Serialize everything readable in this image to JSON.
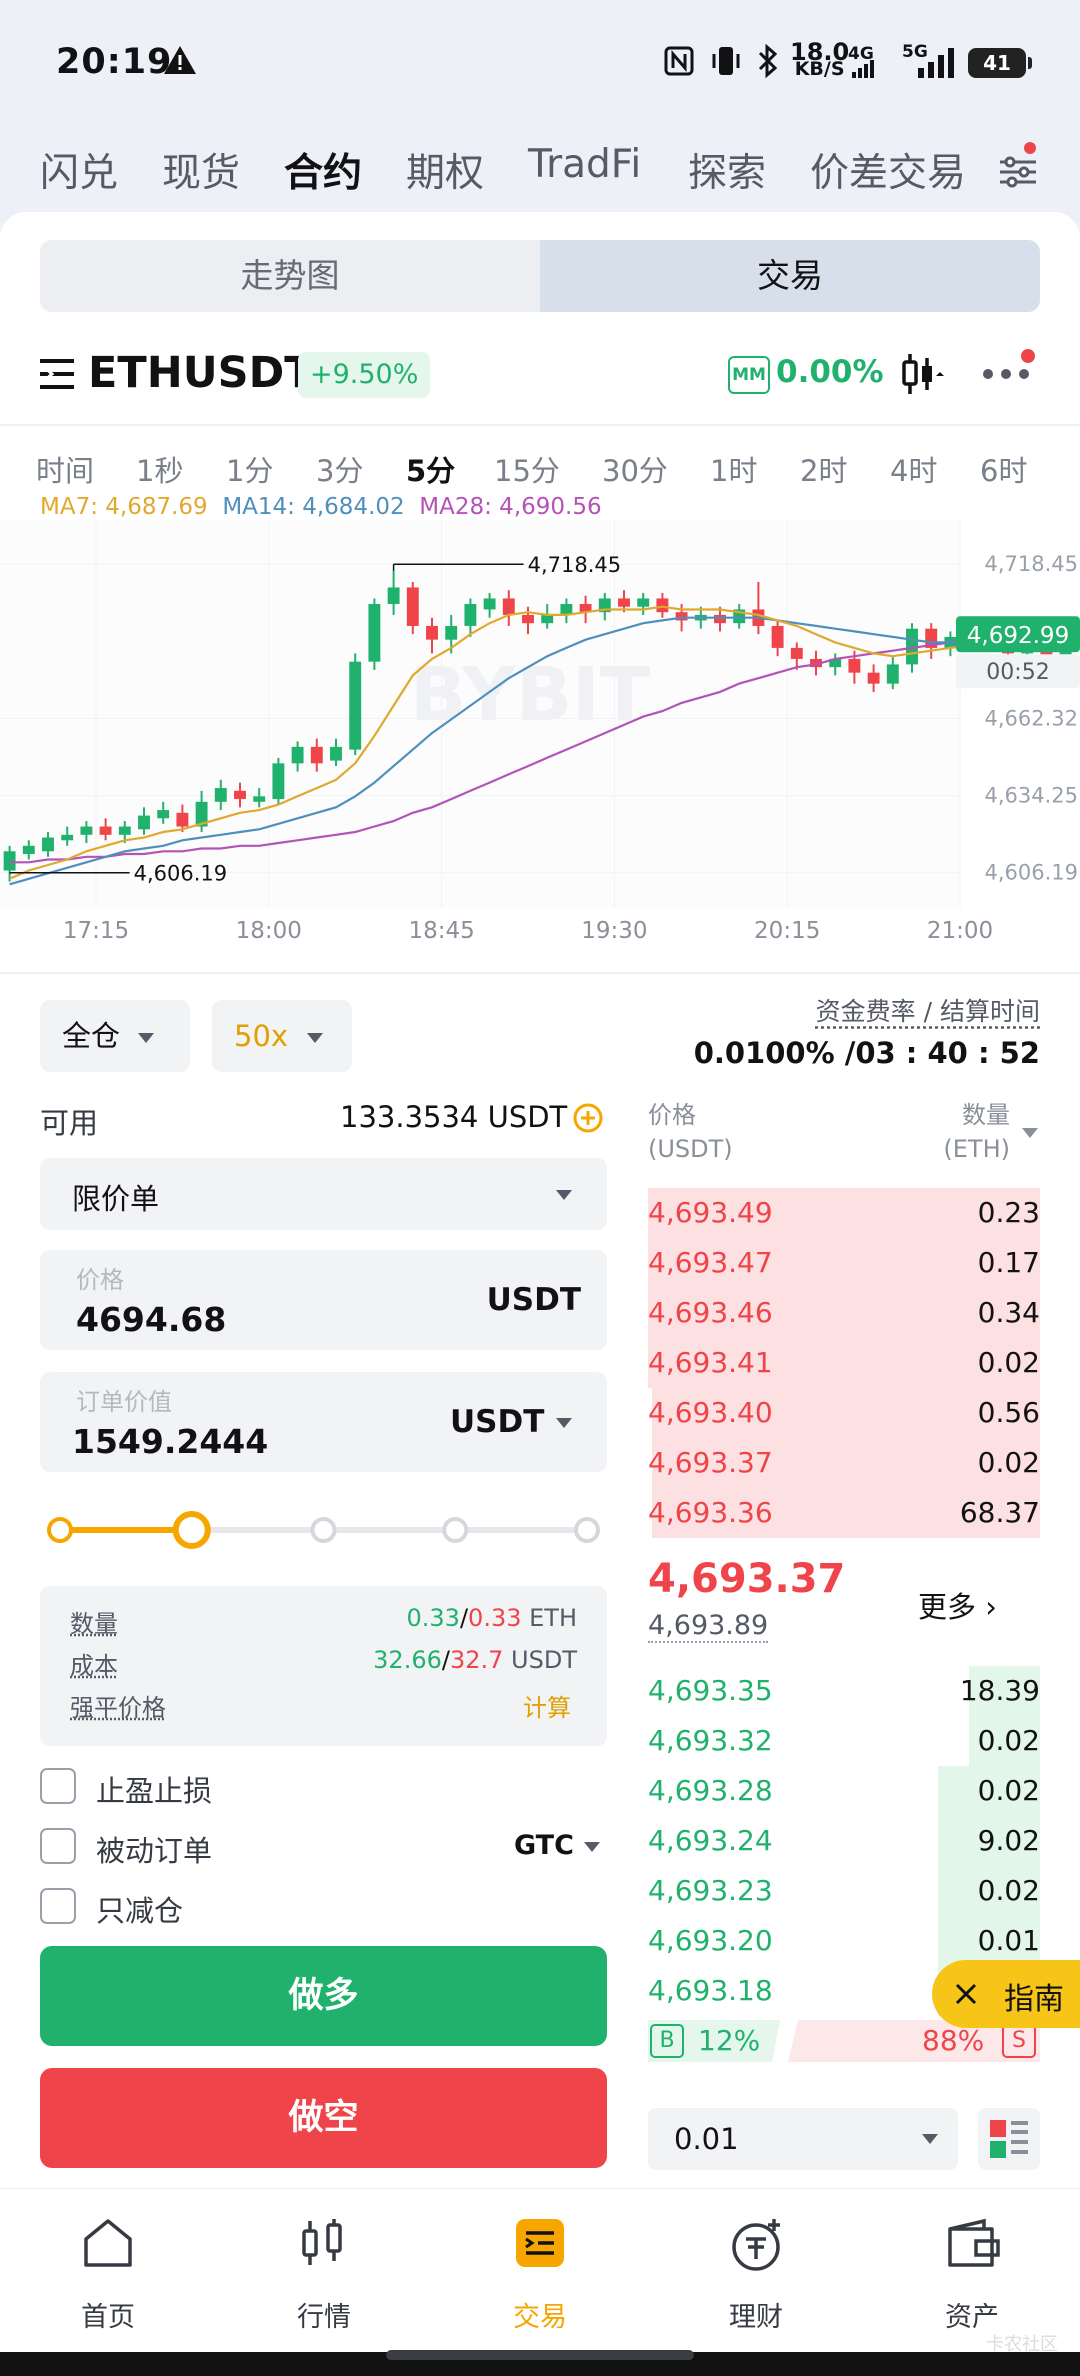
{
  "status_bar": {
    "time": "20:19",
    "net_speed": "18.0",
    "net_unit": "KB/S",
    "signal_4g": "4G",
    "signal_5g": "5G",
    "battery": "41"
  },
  "top_nav": {
    "items": [
      "闪兑",
      "现货",
      "合约",
      "期权",
      "TradFi",
      "探索",
      "价差交易"
    ],
    "active": "合约"
  },
  "view_tabs": {
    "chart": "走势图",
    "trade": "交易"
  },
  "instrument": {
    "symbol": "ETHUSDT",
    "change": "+9.50%",
    "mm_badge": "MM",
    "mm_value": "0.00%"
  },
  "timeframes": [
    "时间",
    "1秒",
    "1分",
    "3分",
    "5分",
    "15分",
    "30分",
    "1时",
    "2时",
    "4时",
    "6时"
  ],
  "active_timeframe": "5分",
  "ma": {
    "ma7": "MA7: 4,687.69",
    "ma14": "MA14: 4,684.02",
    "ma28": "MA28: 4,690.56"
  },
  "chart_data": {
    "type": "candlestick",
    "watermark": "BYBIT",
    "y_ticks": [
      "4,718.45",
      "4,662.32",
      "4,634.25",
      "4,606.19"
    ],
    "x_ticks": [
      "17:15",
      "18:00",
      "18:45",
      "19:30",
      "20:15",
      "21:00"
    ],
    "high_marker": "4,718.45",
    "low_marker": "4,606.19",
    "last_price": "4,692.99",
    "countdown": "00:52",
    "ylim": [
      4597,
      4728
    ],
    "x_range": [
      "16:50",
      "21:00"
    ],
    "interval_minutes": 5,
    "candles": [
      [
        4607,
        4614,
        4603,
        4616
      ],
      [
        4613,
        4616,
        4611,
        4618
      ],
      [
        4614,
        4619,
        4612,
        4621
      ],
      [
        4618,
        4620,
        4616,
        4623
      ],
      [
        4620,
        4623,
        4617,
        4625
      ],
      [
        4623,
        4620,
        4618,
        4626
      ],
      [
        4620,
        4623,
        4617,
        4625
      ],
      [
        4622,
        4627,
        4620,
        4630
      ],
      [
        4626,
        4629,
        4624,
        4632
      ],
      [
        4628,
        4623,
        4621,
        4631
      ],
      [
        4623,
        4632,
        4621,
        4636
      ],
      [
        4632,
        4637,
        4629,
        4640
      ],
      [
        4636,
        4633,
        4630,
        4639
      ],
      [
        4632,
        4634,
        4630,
        4637
      ],
      [
        4633,
        4646,
        4631,
        4648
      ],
      [
        4646,
        4652,
        4643,
        4654
      ],
      [
        4652,
        4646,
        4643,
        4655
      ],
      [
        4647,
        4652,
        4645,
        4655
      ],
      [
        4651,
        4683,
        4649,
        4686
      ],
      [
        4683,
        4704,
        4680,
        4706
      ],
      [
        4704,
        4710,
        4700,
        4716
      ],
      [
        4710,
        4696,
        4693,
        4712
      ],
      [
        4696,
        4691,
        4686,
        4699
      ],
      [
        4691,
        4696,
        4686,
        4700
      ],
      [
        4696,
        4704,
        4692,
        4706
      ],
      [
        4702,
        4706,
        4699,
        4708
      ],
      [
        4706,
        4700,
        4696,
        4709
      ],
      [
        4700,
        4697,
        4693,
        4703
      ],
      [
        4697,
        4700,
        4695,
        4704
      ],
      [
        4700,
        4704,
        4697,
        4706
      ],
      [
        4704,
        4701,
        4697,
        4707
      ],
      [
        4701,
        4706,
        4698,
        4708
      ],
      [
        4706,
        4703,
        4701,
        4709
      ],
      [
        4703,
        4706,
        4700,
        4708
      ],
      [
        4706,
        4701,
        4699,
        4708
      ],
      [
        4701,
        4698,
        4694,
        4704
      ],
      [
        4698,
        4700,
        4695,
        4703
      ],
      [
        4700,
        4697,
        4694,
        4703
      ],
      [
        4697,
        4702,
        4695,
        4704
      ],
      [
        4702,
        4696,
        4693,
        4712
      ],
      [
        4696,
        4688,
        4685,
        4698
      ],
      [
        4688,
        4684,
        4680,
        4690
      ],
      [
        4684,
        4681,
        4678,
        4687
      ],
      [
        4681,
        4684,
        4678,
        4686
      ],
      [
        4684,
        4679,
        4675,
        4687
      ],
      [
        4679,
        4675,
        4672,
        4682
      ],
      [
        4675,
        4682,
        4673,
        4685
      ],
      [
        4682,
        4695,
        4679,
        4697
      ],
      [
        4695,
        4688,
        4684,
        4697
      ],
      [
        4688,
        4692,
        4685,
        4694
      ],
      [
        4692,
        4690,
        4687,
        4695
      ],
      [
        4690,
        4694,
        4687,
        4697
      ],
      [
        4694,
        4686,
        4683,
        4696
      ],
      [
        4686,
        4691,
        4684,
        4693
      ],
      [
        4691,
        4684,
        4680,
        4693
      ],
      [
        4684,
        4693,
        4682,
        4696
      ]
    ],
    "ma7_line": [
      4604,
      4607,
      4609,
      4611,
      4614,
      4616,
      4618,
      4619,
      4621,
      4622,
      4624,
      4626,
      4628,
      4629,
      4631,
      4634,
      4637,
      4640,
      4646,
      4656,
      4667,
      4678,
      4684,
      4688,
      4693,
      4697,
      4700,
      4701,
      4700,
      4700,
      4701,
      4702,
      4702,
      4702,
      4703,
      4702,
      4702,
      4702,
      4701,
      4700,
      4698,
      4696,
      4693,
      4690,
      4688,
      4686,
      4685,
      4686,
      4687,
      4688,
      4689,
      4690,
      4690,
      4689,
      4688,
      4688
    ],
    "ma14_line": [
      4602,
      4604,
      4606,
      4608,
      4610,
      4612,
      4614,
      4615,
      4616,
      4618,
      4619,
      4620,
      4621,
      4622,
      4624,
      4626,
      4628,
      4630,
      4634,
      4639,
      4645,
      4651,
      4657,
      4662,
      4667,
      4672,
      4677,
      4681,
      4685,
      4688,
      4691,
      4693,
      4695,
      4697,
      4698,
      4699,
      4699,
      4699,
      4699,
      4699,
      4698,
      4697,
      4696,
      4695,
      4694,
      4693,
      4692,
      4691,
      4690,
      4690,
      4689,
      4689,
      4689,
      4688,
      4688,
      4688
    ],
    "ma28_line": [
      4610,
      4610,
      4611,
      4611,
      4612,
      4612,
      4613,
      4613,
      4614,
      4614,
      4615,
      4615,
      4616,
      4616,
      4617,
      4618,
      4619,
      4620,
      4621,
      4623,
      4625,
      4628,
      4630,
      4633,
      4636,
      4639,
      4642,
      4645,
      4648,
      4651,
      4654,
      4657,
      4660,
      4663,
      4665,
      4668,
      4670,
      4672,
      4675,
      4677,
      4679,
      4681,
      4682,
      4684,
      4685,
      4686,
      4687,
      4688,
      4689,
      4690,
      4690,
      4691,
      4691,
      4691,
      4691,
      4691
    ]
  },
  "margin_mode": "全仓",
  "leverage": "50x",
  "funding": {
    "label": "资金费率 / 结算时间",
    "value": "0.0100% /03 : 40 : 52"
  },
  "available": {
    "label": "可用",
    "value": "133.3534 USDT"
  },
  "order_type": "限价单",
  "price_field": {
    "label": "价格",
    "value": "4694.68",
    "unit": "USDT"
  },
  "value_field": {
    "label": "订单价值",
    "value": "1549.2444",
    "unit": "USDT"
  },
  "slider_percent": 25,
  "summary": {
    "qty_label": "数量",
    "qty_a": "0.33",
    "qty_b": "0.33",
    "qty_unit": "ETH",
    "cost_label": "成本",
    "cost_a": "32.66",
    "cost_b": "32.7",
    "cost_unit": "USDT",
    "liq_label": "强平价格",
    "liq_value": "计算"
  },
  "options": {
    "tpsl": "止盈止损",
    "post_only": "被动订单",
    "tif": "GTC",
    "reduce_only": "只减仓"
  },
  "buttons": {
    "long": "做多",
    "short": "做空"
  },
  "orderbook": {
    "price_header": "价格",
    "price_unit": "(USDT)",
    "qty_header": "数量",
    "qty_unit": "(ETH)",
    "asks": [
      {
        "price": "4,693.49",
        "qty": "0.23",
        "depth": 1.0
      },
      {
        "price": "4,693.47",
        "qty": "0.17",
        "depth": 1.0
      },
      {
        "price": "4,693.46",
        "qty": "0.34",
        "depth": 1.0
      },
      {
        "price": "4,693.41",
        "qty": "0.02",
        "depth": 1.0
      },
      {
        "price": "4,693.40",
        "qty": "0.56",
        "depth": 0.99
      },
      {
        "price": "4,693.37",
        "qty": "0.02",
        "depth": 0.99
      },
      {
        "price": "4,693.36",
        "qty": "68.37",
        "depth": 0.99
      }
    ],
    "last": "4,693.37",
    "mark": "4,693.89",
    "more": "更多",
    "bids": [
      {
        "price": "4,693.35",
        "qty": "18.39",
        "depth": 0.18
      },
      {
        "price": "4,693.32",
        "qty": "0.02",
        "depth": 0.18
      },
      {
        "price": "4,693.28",
        "qty": "0.02",
        "depth": 0.26
      },
      {
        "price": "4,693.24",
        "qty": "9.02",
        "depth": 0.26
      },
      {
        "price": "4,693.23",
        "qty": "0.02",
        "depth": 0.26
      },
      {
        "price": "4,693.20",
        "qty": "0.01",
        "depth": 0.26
      },
      {
        "price": "4,693.18",
        "qty": "",
        "depth": 0.26
      }
    ],
    "buy_badge": "B",
    "buy_pct": "12%",
    "sell_pct": "88%",
    "sell_badge": "S",
    "precision": "0.01"
  },
  "guide": {
    "label": "指南"
  },
  "bottom_nav": [
    {
      "label": "首页",
      "icon": "home-icon"
    },
    {
      "label": "行情",
      "icon": "candles-icon"
    },
    {
      "label": "交易",
      "icon": "trade-icon"
    },
    {
      "label": "理财",
      "icon": "earn-icon"
    },
    {
      "label": "资产",
      "icon": "wallet-icon"
    }
  ],
  "watermark_corner": "卡农社区",
  "colors": {
    "green": "#20b26c",
    "red": "#ef454a",
    "gold": "#f7a600",
    "ma7": "#e0a92e",
    "ma14": "#4f8fbd",
    "ma28": "#b552b8"
  }
}
